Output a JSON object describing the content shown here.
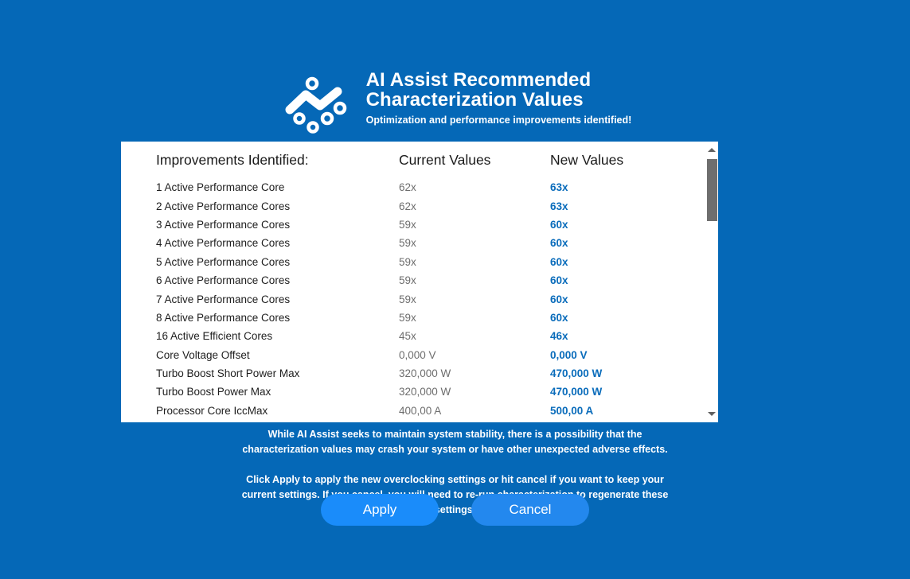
{
  "theme": {
    "background_blue": "#0568b7",
    "panel_white": "#ffffff",
    "accent_blue": "#0a6cbb",
    "button_blue": "#1a8cfa",
    "current_value_gray": "#6d6d6d"
  },
  "header": {
    "logo_icon": "ai-assist-scatter-logo-icon",
    "title_line1": "AI Assist Recommended",
    "title_line2": "Characterization Values",
    "subtitle": "Optimization and performance improvements identified!"
  },
  "table": {
    "columns": [
      "Improvements Identified:",
      "Current Values",
      "New Values"
    ],
    "rows": [
      {
        "name": "1 Active Performance Core",
        "current": "62x",
        "new": "63x"
      },
      {
        "name": "2 Active Performance Cores",
        "current": "62x",
        "new": "63x"
      },
      {
        "name": "3 Active Performance Cores",
        "current": "59x",
        "new": "60x"
      },
      {
        "name": "4 Active Performance Cores",
        "current": "59x",
        "new": "60x"
      },
      {
        "name": "5 Active Performance Cores",
        "current": "59x",
        "new": "60x"
      },
      {
        "name": "6 Active Performance Cores",
        "current": "59x",
        "new": "60x"
      },
      {
        "name": "7 Active Performance Cores",
        "current": "59x",
        "new": "60x"
      },
      {
        "name": "8 Active Performance Cores",
        "current": "59x",
        "new": "60x"
      },
      {
        "name": "16 Active Efficient Cores",
        "current": "45x",
        "new": "46x"
      },
      {
        "name": "Core Voltage Offset",
        "current": "0,000 V",
        "new": "0,000 V"
      },
      {
        "name": "Turbo Boost Short Power Max",
        "current": "320,000 W",
        "new": "470,000 W"
      },
      {
        "name": "Turbo Boost Power Max",
        "current": "320,000 W",
        "new": "470,000 W"
      },
      {
        "name": "Processor Core IccMax",
        "current": "400,00 A",
        "new": "500,00 A"
      }
    ],
    "scrollbar": {
      "up_arrow_icon": "scroll-up-arrow-icon",
      "down_arrow_icon": "scroll-down-arrow-icon"
    }
  },
  "footer": {
    "warning": "While AI Assist seeks to maintain system stability, there is a possibility that the characterization values may crash your system or have other unexpected adverse effects.",
    "instruction": "Click Apply to apply the new overclocking settings or hit cancel if you want to keep your current settings. If you cancel, you will need to re-run characterization to regenerate these settings."
  },
  "buttons": {
    "apply_label": "Apply",
    "cancel_label": "Cancel"
  }
}
